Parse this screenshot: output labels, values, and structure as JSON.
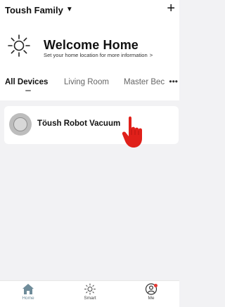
{
  "header": {
    "family_name": "Toush Family",
    "add_label": "+"
  },
  "welcome": {
    "title": "Welcome Home",
    "subtitle": "Set your home location for more information",
    "arrow": ">"
  },
  "tabs": [
    {
      "label": "All Devices",
      "active": true
    },
    {
      "label": "Living Room",
      "active": false
    },
    {
      "label": "Master Bec",
      "active": false
    }
  ],
  "tabs_more": "•••",
  "devices": [
    {
      "name": "Töush Robot Vacuum",
      "icon": "robot-vacuum-icon"
    }
  ],
  "bottom_nav": [
    {
      "label": "Home",
      "icon": "home-icon",
      "active": true
    },
    {
      "label": "Smart",
      "icon": "sun-icon",
      "active": false
    },
    {
      "label": "Me",
      "icon": "profile-icon",
      "active": false,
      "badge": true
    }
  ],
  "colors": {
    "active_nav": "#6f8c9a",
    "badge": "#e53935",
    "hand": "#e0201a"
  }
}
